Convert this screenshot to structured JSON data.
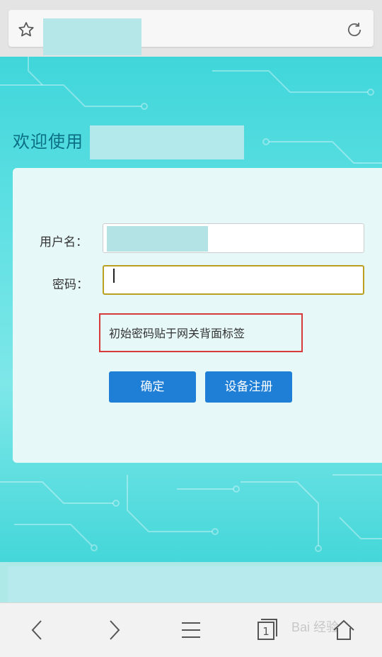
{
  "browser": {
    "bookmark_icon": "star-icon",
    "reload_icon": "reload-icon"
  },
  "page": {
    "welcome_text": "欢迎使用",
    "form": {
      "username_label": "用户名：",
      "password_label": "密码：",
      "hint": "初始密码贴于网关背面标签",
      "submit_label": "确定",
      "register_label": "设备注册"
    }
  },
  "nav": {
    "watermark": "Bai 经验"
  },
  "colors": {
    "accent_button": "#1f7fd6",
    "hint_border": "#d73a3a",
    "welcome_text": "#0b6f86"
  }
}
